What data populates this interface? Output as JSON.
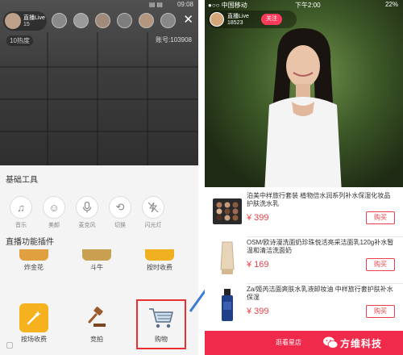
{
  "left": {
    "status": {
      "signal": "▤▤",
      "time": "09:08"
    },
    "host": {
      "name": "直播Live",
      "count": "15"
    },
    "counter": "10热度",
    "account": "账号:103908",
    "section_basic": "基础工具",
    "tools": [
      {
        "label": "音乐",
        "icon": "music-icon"
      },
      {
        "label": "美颜",
        "icon": "beauty-face-icon"
      },
      {
        "label": "麦克风",
        "icon": "microphone-icon"
      },
      {
        "label": "切换",
        "icon": "camera-switch-icon"
      },
      {
        "label": "闪光灯",
        "icon": "flash-off-icon"
      }
    ],
    "section_plugins": "直播功能插件",
    "plugins_row1": [
      {
        "label": "炸金花"
      },
      {
        "label": "斗牛"
      },
      {
        "label": "按时收费"
      }
    ],
    "plugins_row2": [
      {
        "label": "按场收费",
        "icon": "magic-wand-icon"
      },
      {
        "label": "竞拍",
        "icon": "gavel-icon"
      },
      {
        "label": "购物",
        "icon": "shopping-cart-icon"
      }
    ]
  },
  "right": {
    "status": {
      "carrier": "●○○ 中国移动",
      "time": "下午2:00",
      "battery": "22%"
    },
    "host": {
      "name": "直播Live",
      "count": "18523",
      "follow_label": "关注"
    },
    "products": [
      {
        "name": "泊美中样旅行套装 植物倍水润系列补水保湿化妆品 护肤洗水乳",
        "price": "¥ 399",
        "buy_label": "购买",
        "thumb": "eyeshadow-palette-icon"
      },
      {
        "name": "OSM/欧诗漫洗面奶珍珠悦活亮采洁面乳120g补水暂温和清洁洗面奶",
        "price": "¥ 169",
        "buy_label": "购买",
        "thumb": "cleanser-tube-icon"
      },
      {
        "name": "Za/姬芮洁面爽肤水乳液卸妆油 中样旅行套护肤补水保湿",
        "price": "¥ 399",
        "buy_label": "购买",
        "thumb": "skincare-bottle-icon"
      }
    ],
    "store_label": "逛看星店"
  },
  "watermark": "方维科技",
  "colors": {
    "accent": "#f02a4a",
    "price": "#e8424a",
    "highlight": "#e83030",
    "arrow": "#3a7bd5"
  }
}
